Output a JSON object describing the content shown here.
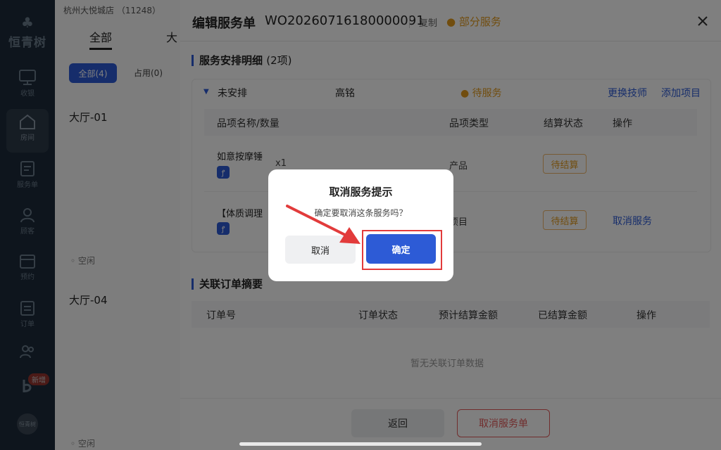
{
  "sidebar": {
    "logo_text": "恒青树",
    "items": [
      {
        "label": "收银",
        "icon": "monitor-icon"
      },
      {
        "label": "房间",
        "icon": "home-icon"
      },
      {
        "label": "服务单",
        "icon": "service-order-icon"
      },
      {
        "label": "顾客",
        "icon": "customer-icon"
      },
      {
        "label": "预约",
        "icon": "calendar-icon"
      },
      {
        "label": "订单",
        "icon": "order-icon"
      },
      {
        "label": "",
        "icon": "staff-icon"
      },
      {
        "label": "",
        "icon": "brand-icon"
      }
    ],
    "new_badge": "新增",
    "avatar_text": "恒青树"
  },
  "background": {
    "store": "杭州大悦城店 （11248）",
    "tab_all": "全部",
    "tab_big": "大",
    "chip_all": "全部(4)",
    "chip_occupied": "占用(0)",
    "rooms": [
      {
        "name": "大厅-01",
        "status": "空闲"
      },
      {
        "name": "大厅-04",
        "status": "空闲"
      }
    ]
  },
  "drawer": {
    "title": "编辑服务单",
    "work_order_no": "WO20260716180000091",
    "copy": "复制",
    "status": "● 部分服务",
    "section1": {
      "title": "服务安排明细",
      "count": "(2项)"
    },
    "group": {
      "arrangement": "未安排",
      "technician": "高铭",
      "status": "● 待服务",
      "change_tech": "更换技师",
      "add_item": "添加项目"
    },
    "table_headers": [
      "品项名称/数量",
      "品项类型",
      "结算状态",
      "操作"
    ],
    "rows": [
      {
        "name": "如意按摩锤",
        "qty": "x1",
        "type": "产品",
        "settle": "待结算",
        "action": ""
      },
      {
        "name": "【体质调理",
        "qty": "",
        "type": "项目",
        "settle": "待结算",
        "action": "取消服务"
      }
    ],
    "section2": {
      "title": "关联订单摘要"
    },
    "order_headers": [
      "订单号",
      "订单状态",
      "预计结算金额",
      "已结算金额",
      "操作"
    ],
    "empty": "暂无关联订单数据",
    "back": "返回",
    "cancel_order": "取消服务单"
  },
  "modal": {
    "title": "取消服务提示",
    "message": "确定要取消这条服务吗？",
    "cancel": "取消",
    "confirm": "确定"
  },
  "colors": {
    "accent": "#2d5bd6",
    "warning": "#e39a1d",
    "danger": "#e25a5a",
    "highlight": "#e23b3b"
  }
}
